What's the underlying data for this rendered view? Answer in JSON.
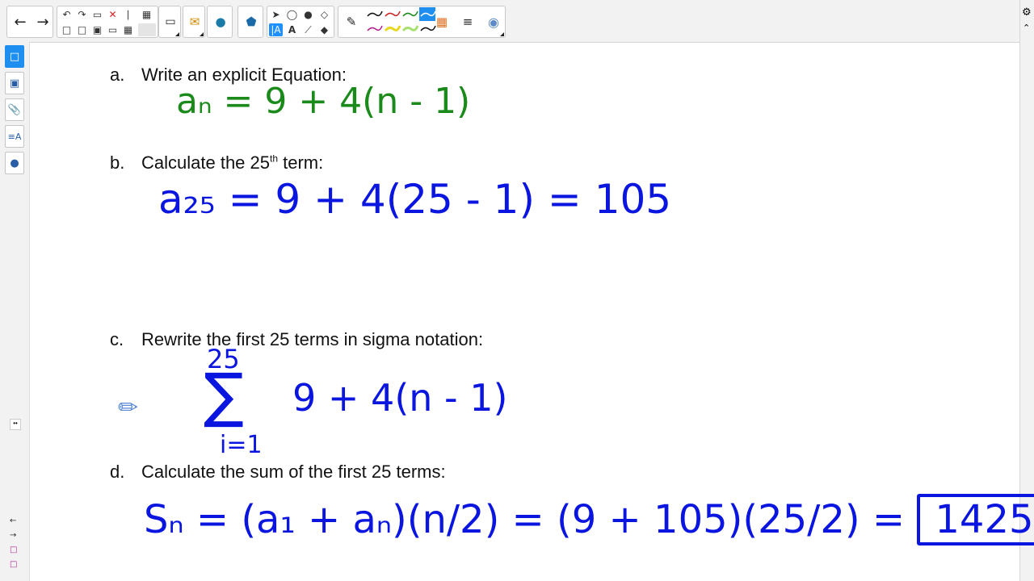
{
  "toolbar": {
    "back_icon": "arrow-left-icon",
    "forward_icon": "arrow-right-icon",
    "groups": [
      "edit",
      "display",
      "add",
      "widgets",
      "shapes-select",
      "pens",
      "palette"
    ]
  },
  "sidebar": {
    "buttons": [
      "page-icon",
      "gallery-icon",
      "attachment-icon",
      "properties-icon",
      "addons-icon"
    ],
    "bottom_arrows": [
      "←",
      "→"
    ]
  },
  "questions": {
    "a": {
      "letter": "a.",
      "text": "Write an explicit Equation:"
    },
    "b": {
      "letter": "b.",
      "text_before": "Calculate the 25",
      "superscript": "th",
      "text_after": " term:"
    },
    "c": {
      "letter": "c.",
      "text": "Rewrite the first 25 terms in sigma notation:"
    },
    "d": {
      "letter": "d.",
      "text": "Calculate the sum of the first 25 terms:"
    }
  },
  "handwriting": {
    "a_equation": "aₙ = 9 + 4(n - 1)",
    "b_lhs": "a₂₅ = 9 + 4(25 - 1) = ",
    "b_result": "105",
    "c_sigma_top": "25",
    "c_sigma_bottom": "i=1",
    "c_expression": "9 + 4(n - 1)",
    "d_lhs": "Sₙ = (a₁ + aₙ)(n/2) = (9 + 105)(25/2) = ",
    "d_result": "1425"
  },
  "colors": {
    "green_ink": "#1a8a1a",
    "blue_ink": "#0a16e0",
    "active_button": "#1e8ef0"
  }
}
